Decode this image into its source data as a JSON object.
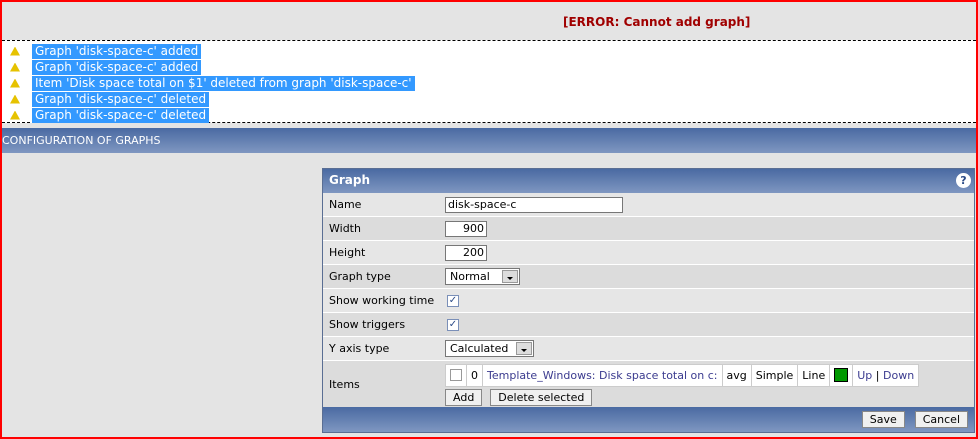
{
  "error": "[ERROR: Cannot add graph]",
  "messages": [
    "Graph 'disk-space-c' added",
    "Graph 'disk-space-c' added",
    "Item 'Disk space total on $1' deleted from graph 'disk-space-c'",
    "Graph 'disk-space-c' deleted",
    "Graph 'disk-space-c' deleted"
  ],
  "section_title": "CONFIGURATION OF GRAPHS",
  "form": {
    "title": "Graph",
    "help": "?",
    "name_label": "Name",
    "name_value": "disk-space-c",
    "width_label": "Width",
    "width_value": "900",
    "height_label": "Height",
    "height_value": "200",
    "graph_type_label": "Graph type",
    "graph_type_value": "Normal",
    "working_time_label": "Show working time",
    "working_time_checked": true,
    "triggers_label": "Show triggers",
    "triggers_checked": true,
    "yaxis_label": "Y axis type",
    "yaxis_value": "Calculated",
    "items_label": "Items",
    "item": {
      "sortorder": "0",
      "name": "Template_Windows: Disk space total on c:",
      "function": "avg",
      "draw": "Simple",
      "type": "Line",
      "color": "#009900",
      "up": "Up",
      "sep": "|",
      "down": "Down"
    },
    "add": "Add",
    "delete_selected": "Delete selected",
    "save": "Save",
    "cancel": "Cancel"
  }
}
